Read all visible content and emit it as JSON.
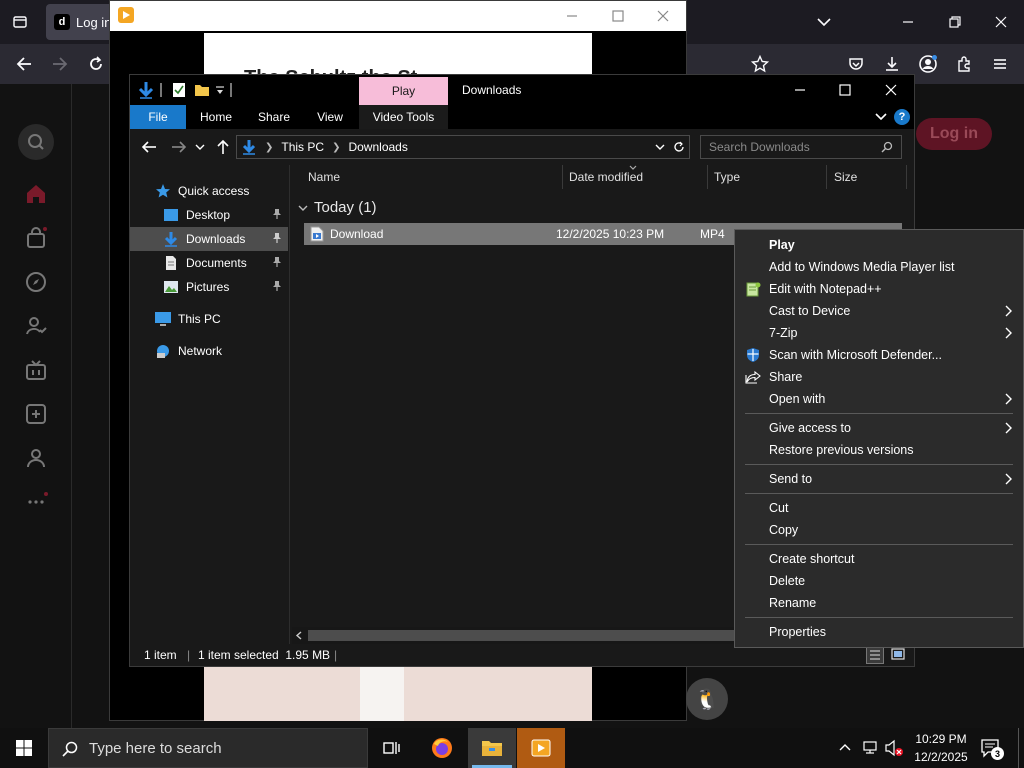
{
  "browser": {
    "tab_title": "Log in",
    "tiktok_logo": "d",
    "login_label": "Log in",
    "video_title": "The Schultz the St..."
  },
  "media_player": {
    "title": ""
  },
  "explorer": {
    "title": "Downloads",
    "contextual_tab": "Play",
    "ribbon_tabs": {
      "file": "File",
      "home": "Home",
      "share": "Share",
      "view": "View",
      "video_tools": "Video Tools"
    },
    "help_glyph": "?",
    "breadcrumb": [
      "This PC",
      "Downloads"
    ],
    "search_placeholder": "Search Downloads",
    "nav": {
      "quick_access": "Quick access",
      "desktop": "Desktop",
      "downloads": "Downloads",
      "documents": "Documents",
      "pictures": "Pictures",
      "this_pc": "This PC",
      "network": "Network"
    },
    "columns": {
      "name": "Name",
      "date_modified": "Date modified",
      "type": "Type",
      "size": "Size"
    },
    "group_label": "Today (1)",
    "file": {
      "name": "Download",
      "date": "12/2/2025 10:23 PM",
      "type": "MP4"
    },
    "status": {
      "count": "1 item",
      "selected": "1 item selected  1.95 MB"
    }
  },
  "context_menu": {
    "play": "Play",
    "add_wmp": "Add to Windows Media Player list",
    "edit_notepad": "Edit with Notepad++",
    "cast": "Cast to Device",
    "zip": "7-Zip",
    "defender": "Scan with Microsoft Defender...",
    "share": "Share",
    "open_with": "Open with",
    "give_access": "Give access to",
    "restore": "Restore previous versions",
    "send_to": "Send to",
    "cut": "Cut",
    "copy": "Copy",
    "create_shortcut": "Create shortcut",
    "delete": "Delete",
    "rename": "Rename",
    "properties": "Properties"
  },
  "taskbar": {
    "search_placeholder": "Type here to search",
    "time": "10:29 PM",
    "date": "12/2/2025",
    "notification_count": "3"
  },
  "colors": {
    "file_tab": "#1979ca",
    "play_tab": "#f7bdd9",
    "tiktok_login": "#5e1424",
    "media_player_taskbar": "#b05b12"
  }
}
